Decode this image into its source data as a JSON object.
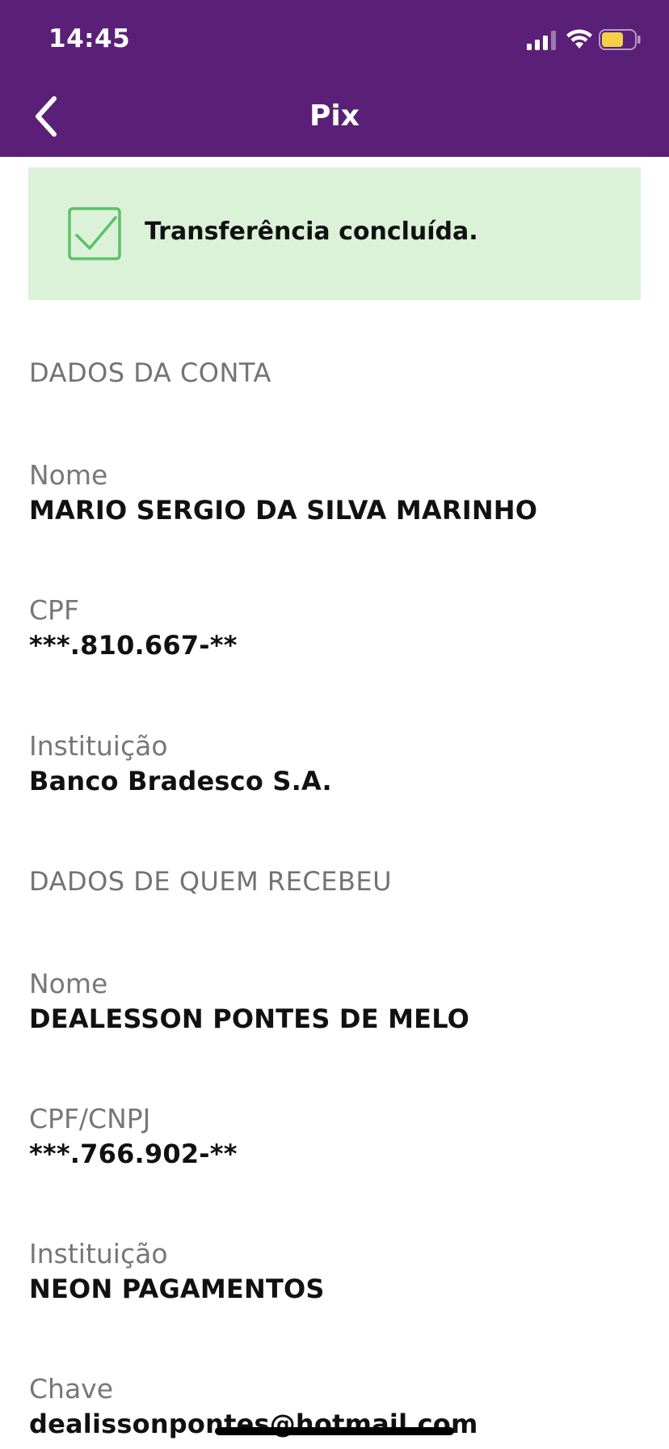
{
  "status_bar": {
    "time": "14:45",
    "signal_icon": "cellular-signal-icon",
    "wifi_icon": "wifi-icon",
    "battery_icon": "battery-icon",
    "battery_color": "#f5cf47"
  },
  "nav": {
    "back_icon": "chevron-left-icon",
    "title": "Pix",
    "background": "#5a2077"
  },
  "banner": {
    "icon": "check-square-icon",
    "text": "Transferência concluída.",
    "background": "#dbf2d9",
    "icon_color": "#5bc266"
  },
  "account_section": {
    "title": "DADOS DA CONTA",
    "name_label": "Nome",
    "name_value": "MARIO SERGIO DA SILVA MARINHO",
    "cpf_label": "CPF",
    "cpf_value": "***.810.667-**",
    "institution_label": "Instituição",
    "institution_value": "Banco Bradesco S.A."
  },
  "recipient_section": {
    "title": "DADOS DE QUEM RECEBEU",
    "name_label": "Nome",
    "name_value": "DEALESSON PONTES DE MELO",
    "doc_label": "CPF/CNPJ",
    "doc_value": "***.766.902-**",
    "institution_label": "Instituição",
    "institution_value": "NEON PAGAMENTOS",
    "key_label": "Chave",
    "key_value": "dealissonpontes@hotmail.com"
  }
}
